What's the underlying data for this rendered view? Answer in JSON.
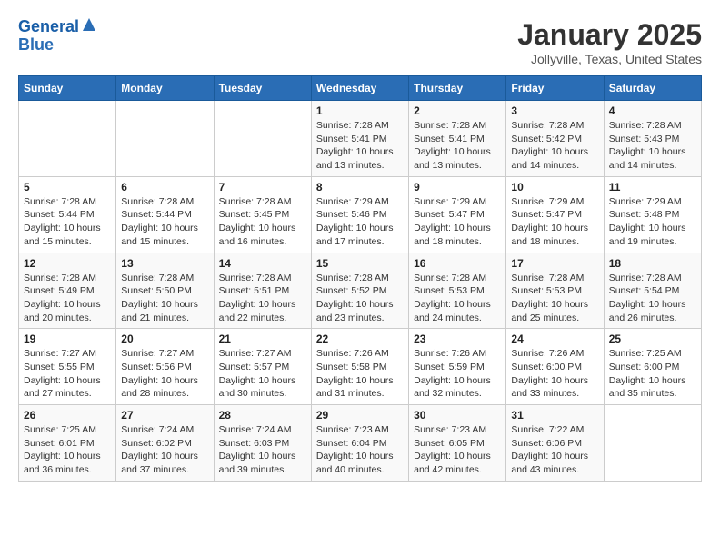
{
  "header": {
    "logo_line1": "General",
    "logo_line2": "Blue",
    "title": "January 2025",
    "subtitle": "Jollyville, Texas, United States"
  },
  "days_of_week": [
    "Sunday",
    "Monday",
    "Tuesday",
    "Wednesday",
    "Thursday",
    "Friday",
    "Saturday"
  ],
  "weeks": [
    {
      "days": [
        {
          "number": "",
          "info": ""
        },
        {
          "number": "",
          "info": ""
        },
        {
          "number": "",
          "info": ""
        },
        {
          "number": "1",
          "info": "Sunrise: 7:28 AM\nSunset: 5:41 PM\nDaylight: 10 hours\nand 13 minutes."
        },
        {
          "number": "2",
          "info": "Sunrise: 7:28 AM\nSunset: 5:41 PM\nDaylight: 10 hours\nand 13 minutes."
        },
        {
          "number": "3",
          "info": "Sunrise: 7:28 AM\nSunset: 5:42 PM\nDaylight: 10 hours\nand 14 minutes."
        },
        {
          "number": "4",
          "info": "Sunrise: 7:28 AM\nSunset: 5:43 PM\nDaylight: 10 hours\nand 14 minutes."
        }
      ]
    },
    {
      "days": [
        {
          "number": "5",
          "info": "Sunrise: 7:28 AM\nSunset: 5:44 PM\nDaylight: 10 hours\nand 15 minutes."
        },
        {
          "number": "6",
          "info": "Sunrise: 7:28 AM\nSunset: 5:44 PM\nDaylight: 10 hours\nand 15 minutes."
        },
        {
          "number": "7",
          "info": "Sunrise: 7:28 AM\nSunset: 5:45 PM\nDaylight: 10 hours\nand 16 minutes."
        },
        {
          "number": "8",
          "info": "Sunrise: 7:29 AM\nSunset: 5:46 PM\nDaylight: 10 hours\nand 17 minutes."
        },
        {
          "number": "9",
          "info": "Sunrise: 7:29 AM\nSunset: 5:47 PM\nDaylight: 10 hours\nand 18 minutes."
        },
        {
          "number": "10",
          "info": "Sunrise: 7:29 AM\nSunset: 5:47 PM\nDaylight: 10 hours\nand 18 minutes."
        },
        {
          "number": "11",
          "info": "Sunrise: 7:29 AM\nSunset: 5:48 PM\nDaylight: 10 hours\nand 19 minutes."
        }
      ]
    },
    {
      "days": [
        {
          "number": "12",
          "info": "Sunrise: 7:28 AM\nSunset: 5:49 PM\nDaylight: 10 hours\nand 20 minutes."
        },
        {
          "number": "13",
          "info": "Sunrise: 7:28 AM\nSunset: 5:50 PM\nDaylight: 10 hours\nand 21 minutes."
        },
        {
          "number": "14",
          "info": "Sunrise: 7:28 AM\nSunset: 5:51 PM\nDaylight: 10 hours\nand 22 minutes."
        },
        {
          "number": "15",
          "info": "Sunrise: 7:28 AM\nSunset: 5:52 PM\nDaylight: 10 hours\nand 23 minutes."
        },
        {
          "number": "16",
          "info": "Sunrise: 7:28 AM\nSunset: 5:53 PM\nDaylight: 10 hours\nand 24 minutes."
        },
        {
          "number": "17",
          "info": "Sunrise: 7:28 AM\nSunset: 5:53 PM\nDaylight: 10 hours\nand 25 minutes."
        },
        {
          "number": "18",
          "info": "Sunrise: 7:28 AM\nSunset: 5:54 PM\nDaylight: 10 hours\nand 26 minutes."
        }
      ]
    },
    {
      "days": [
        {
          "number": "19",
          "info": "Sunrise: 7:27 AM\nSunset: 5:55 PM\nDaylight: 10 hours\nand 27 minutes."
        },
        {
          "number": "20",
          "info": "Sunrise: 7:27 AM\nSunset: 5:56 PM\nDaylight: 10 hours\nand 28 minutes."
        },
        {
          "number": "21",
          "info": "Sunrise: 7:27 AM\nSunset: 5:57 PM\nDaylight: 10 hours\nand 30 minutes."
        },
        {
          "number": "22",
          "info": "Sunrise: 7:26 AM\nSunset: 5:58 PM\nDaylight: 10 hours\nand 31 minutes."
        },
        {
          "number": "23",
          "info": "Sunrise: 7:26 AM\nSunset: 5:59 PM\nDaylight: 10 hours\nand 32 minutes."
        },
        {
          "number": "24",
          "info": "Sunrise: 7:26 AM\nSunset: 6:00 PM\nDaylight: 10 hours\nand 33 minutes."
        },
        {
          "number": "25",
          "info": "Sunrise: 7:25 AM\nSunset: 6:00 PM\nDaylight: 10 hours\nand 35 minutes."
        }
      ]
    },
    {
      "days": [
        {
          "number": "26",
          "info": "Sunrise: 7:25 AM\nSunset: 6:01 PM\nDaylight: 10 hours\nand 36 minutes."
        },
        {
          "number": "27",
          "info": "Sunrise: 7:24 AM\nSunset: 6:02 PM\nDaylight: 10 hours\nand 37 minutes."
        },
        {
          "number": "28",
          "info": "Sunrise: 7:24 AM\nSunset: 6:03 PM\nDaylight: 10 hours\nand 39 minutes."
        },
        {
          "number": "29",
          "info": "Sunrise: 7:23 AM\nSunset: 6:04 PM\nDaylight: 10 hours\nand 40 minutes."
        },
        {
          "number": "30",
          "info": "Sunrise: 7:23 AM\nSunset: 6:05 PM\nDaylight: 10 hours\nand 42 minutes."
        },
        {
          "number": "31",
          "info": "Sunrise: 7:22 AM\nSunset: 6:06 PM\nDaylight: 10 hours\nand 43 minutes."
        },
        {
          "number": "",
          "info": ""
        }
      ]
    }
  ]
}
